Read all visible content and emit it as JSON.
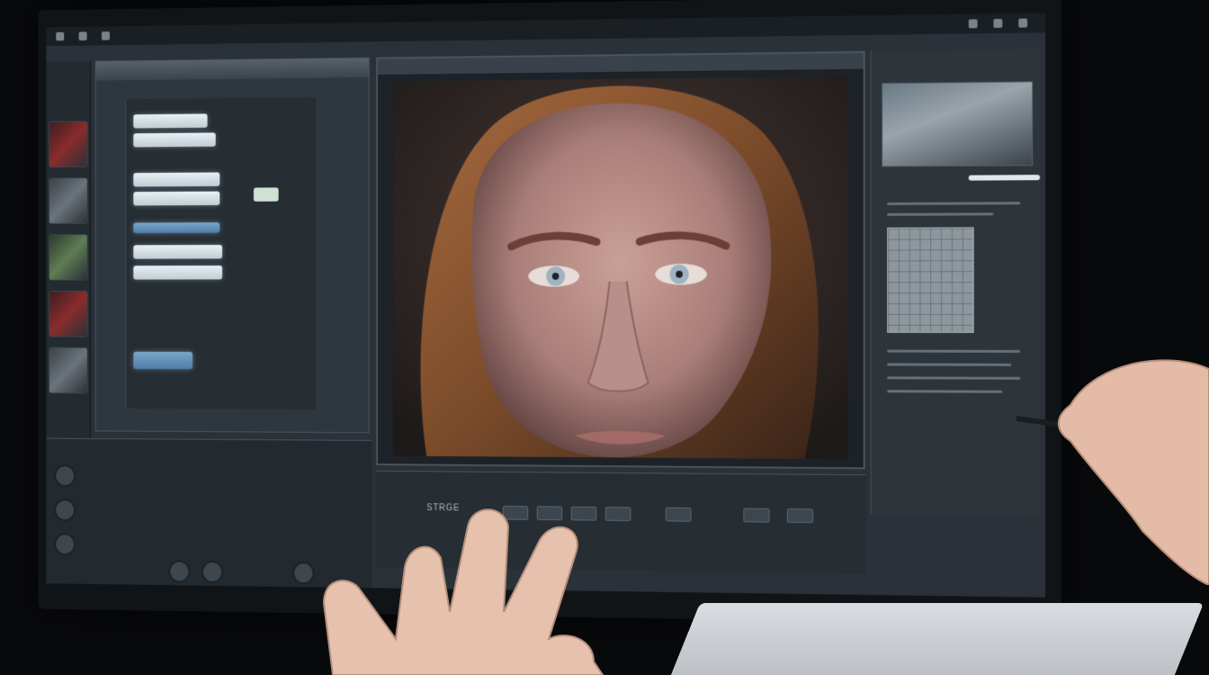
{
  "scene": {
    "subject": "monitor-with-3d-face-editor",
    "colors": {
      "ui_background": "#2a3138",
      "panel": "#2f373e",
      "highlight": "#e8f0f4",
      "skin": "#b98d83",
      "hair": "#8a5630",
      "iris": "#9fb2c0"
    }
  },
  "transport": {
    "label": "STRGE"
  }
}
